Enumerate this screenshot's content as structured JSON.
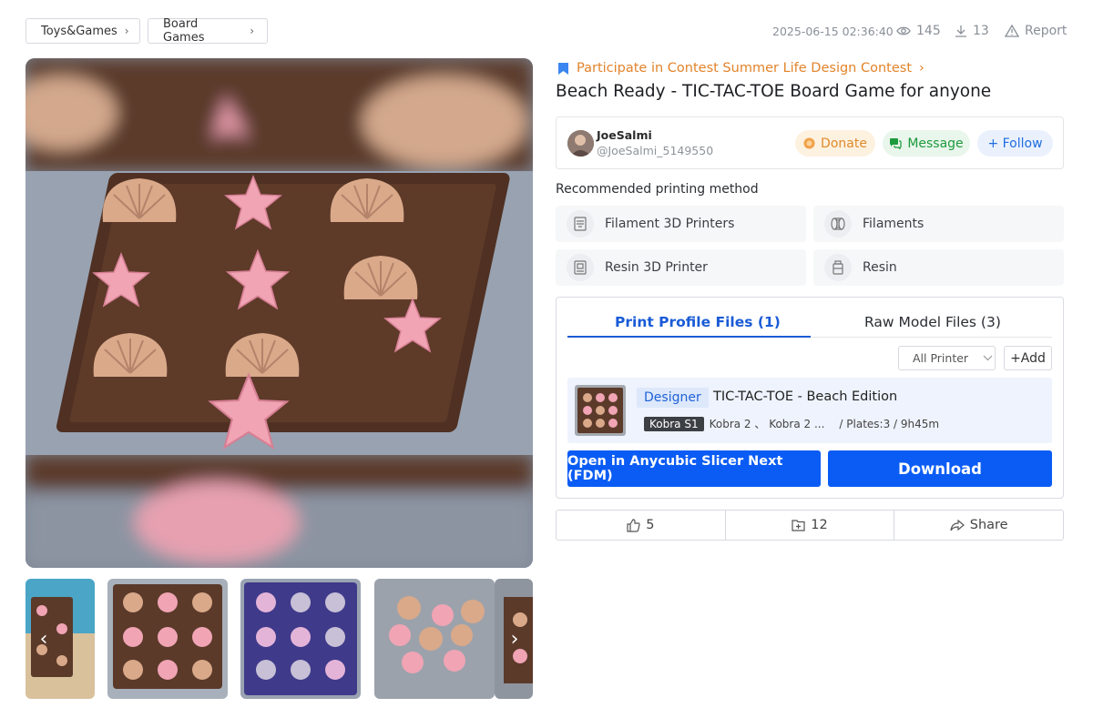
{
  "breadcrumbs": [
    {
      "label": "Toys&Games"
    },
    {
      "label": "Board Games"
    }
  ],
  "meta": {
    "date": "2025-06-15 02:36:40",
    "views": "145",
    "downloads": "13",
    "report": "Report"
  },
  "contest": {
    "label": "Participate in Contest Summer Life Design Contest"
  },
  "title": "Beach Ready - TIC-TAC-TOE Board Game for anyone",
  "author": {
    "name": "JoeSalmi",
    "handle": "@JoeSalmi_5149550",
    "donate": "Donate",
    "message": "Message",
    "follow": "+ Follow"
  },
  "recommended": {
    "label": "Recommended printing method",
    "methods": [
      {
        "label": "Filament 3D Printers",
        "icon": "filament-printer-icon"
      },
      {
        "label": "Filaments",
        "icon": "filament-spool-icon"
      },
      {
        "label": "Resin 3D Printer",
        "icon": "resin-printer-icon"
      },
      {
        "label": "Resin",
        "icon": "resin-bottle-icon"
      }
    ]
  },
  "files": {
    "tabs": [
      {
        "label": "Print Profile Files (1)",
        "active": true
      },
      {
        "label": "Raw Model Files (3)",
        "active": false
      }
    ],
    "printer_filter": "All Printer",
    "add": "+Add",
    "profile": {
      "badge": "Designer",
      "name": "TIC-TAC-TOE - Beach Edition",
      "printer_primary": "Kobra S1",
      "printers_other": "Kobra 2 、 Kobra 2 ...",
      "details": "/ Plates:3 / 9h45m"
    },
    "open_button": "Open in Anycubic Slicer Next (FDM)",
    "download_button": "Download"
  },
  "actions": {
    "likes": "5",
    "collects": "12",
    "share": "Share"
  },
  "colors": {
    "accent": "#0a5cf4",
    "contest": "#e2832a",
    "board": "#5b3a2a",
    "shell": "#d9a98a",
    "star": "#f0a4b4"
  }
}
